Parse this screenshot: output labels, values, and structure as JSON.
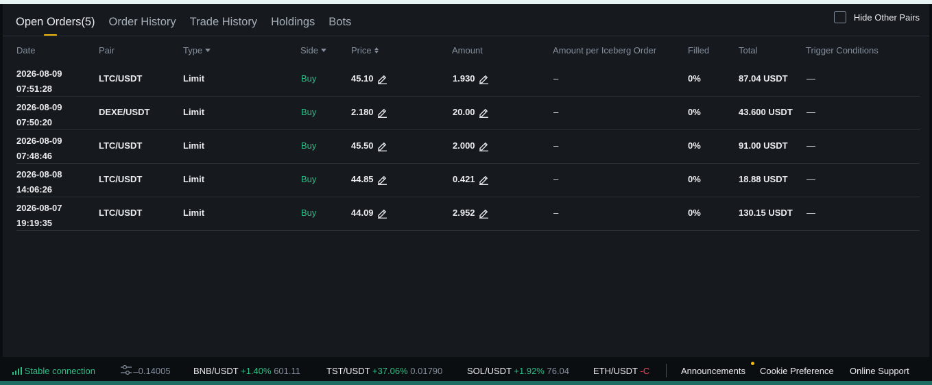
{
  "tabs": [
    {
      "label": "Open Orders(5)"
    },
    {
      "label": "Order History"
    },
    {
      "label": "Trade History"
    },
    {
      "label": "Holdings"
    },
    {
      "label": "Bots"
    }
  ],
  "hide_other_pairs": {
    "label": "Hide Other Pairs",
    "checked": false
  },
  "columns": {
    "date": "Date",
    "pair": "Pair",
    "type": "Type",
    "side": "Side",
    "price": "Price",
    "amount": "Amount",
    "iceberg": "Amount per Iceberg Order",
    "filled": "Filled",
    "total": "Total",
    "trigger": "Trigger Conditions"
  },
  "orders": [
    {
      "date": "2026-08-09",
      "time": "07:51:28",
      "pair": "LTC/USDT",
      "type": "Limit",
      "side": "Buy",
      "price": "45.10",
      "amount": "1.930",
      "iceberg": "–",
      "filled": "0%",
      "total": "87.04 USDT",
      "trigger": "—"
    },
    {
      "date": "2026-08-09",
      "time": "07:50:20",
      "pair": "DEXE/USDT",
      "type": "Limit",
      "side": "Buy",
      "price": "2.180",
      "amount": "20.00",
      "iceberg": "–",
      "filled": "0%",
      "total": "43.600 USDT",
      "trigger": "—"
    },
    {
      "date": "2026-08-09",
      "time": "07:48:46",
      "pair": "LTC/USDT",
      "type": "Limit",
      "side": "Buy",
      "price": "45.50",
      "amount": "2.000",
      "iceberg": "–",
      "filled": "0%",
      "total": "91.00 USDT",
      "trigger": "—"
    },
    {
      "date": "2026-08-08",
      "time": "14:06:26",
      "pair": "LTC/USDT",
      "type": "Limit",
      "side": "Buy",
      "price": "44.85",
      "amount": "0.421",
      "iceberg": "–",
      "filled": "0%",
      "total": "18.88 USDT",
      "trigger": "—"
    },
    {
      "date": "2026-08-07",
      "time": "19:19:35",
      "pair": "LTC/USDT",
      "type": "Limit",
      "side": "Buy",
      "price": "44.09",
      "amount": "2.952",
      "iceberg": "–",
      "filled": "0%",
      "total": "130.15 USDT",
      "trigger": "—"
    }
  ],
  "footer": {
    "connection": "Stable connection",
    "ticker": [
      {
        "pair": "",
        "change": "",
        "price": "̶ 0.14005"
      },
      {
        "pair": "BNB/USDT",
        "change": "+1.40%",
        "price": "601.11"
      },
      {
        "pair": "TST/USDT",
        "change": "+37.06%",
        "price": "0.01790"
      },
      {
        "pair": "SOL/USDT",
        "change": "+1.92%",
        "price": "76.04"
      },
      {
        "pair": "ETH/USDT",
        "change": "-C",
        "price": ""
      }
    ],
    "links": [
      "Announcements",
      "Cookie Preference",
      "Online Support"
    ]
  },
  "colors": {
    "buy": "#2ebd85",
    "accent": "#f0b90b",
    "negative": "#f6465d",
    "background": "#161a1e"
  }
}
